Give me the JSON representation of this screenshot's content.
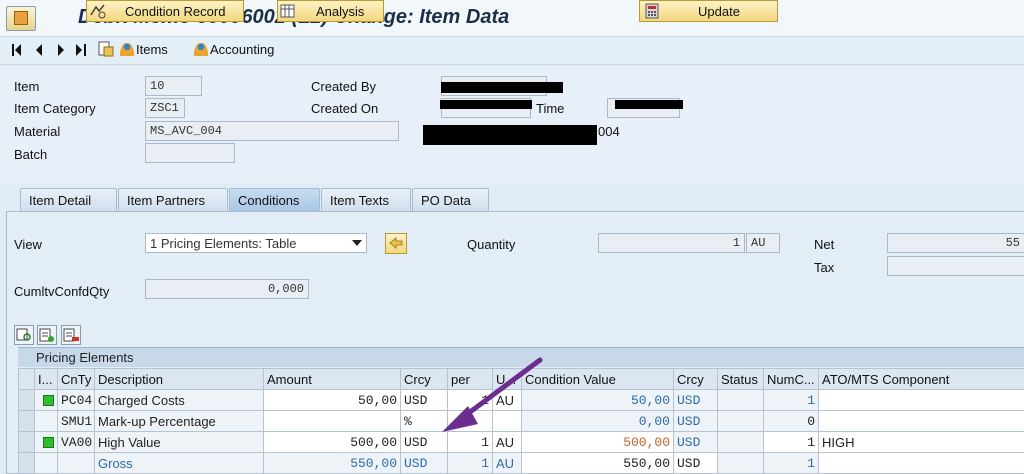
{
  "window": {
    "title": "Debit Memo 90006002  (L2) Change: Item Data"
  },
  "toolbar": {
    "items_label": "Items",
    "accounting_label": "Accounting"
  },
  "header": {
    "item_label": "Item",
    "item_value": "10",
    "item_category_label": "Item Category",
    "item_category_value": "ZSC1",
    "material_label": "Material",
    "material_value": "MS_AVC_004",
    "material_desc_suffix": "004",
    "batch_label": "Batch",
    "created_by_label": "Created By",
    "created_on_label": "Created On",
    "time_label": "Time"
  },
  "tabs": [
    {
      "label": "Item Detail"
    },
    {
      "label": "Item Partners"
    },
    {
      "label": "Conditions"
    },
    {
      "label": "Item Texts"
    },
    {
      "label": "PO Data"
    }
  ],
  "conditions": {
    "view_label": "View",
    "view_value": "1 Pricing Elements: Table",
    "quantity_label": "Quantity",
    "quantity_value": "1",
    "quantity_unit": "AU",
    "net_label": "Net",
    "net_value": "55",
    "tax_label": "Tax",
    "cumltv_label": "CumltvConfdQty",
    "cumltv_value": "0,000",
    "condition_record_label": "Condition Record",
    "analysis_label": "Analysis",
    "update_label": "Update",
    "pricing_elements_title": "Pricing Elements"
  },
  "grid": {
    "headers": [
      "I...",
      "CnTy",
      "Description",
      "Amount",
      "Crcy",
      "per",
      "U...",
      "Condition Value",
      "Crcy",
      "Status",
      "NumC...",
      "ATO/MTS Component"
    ],
    "rows": [
      {
        "cnty": "PC04",
        "desc": "Charged Costs",
        "amount": "50,00",
        "crcy": "USD",
        "per": "1",
        "uom": "AU",
        "cond_value": "50,00",
        "crcy2": "USD",
        "status": "",
        "numc": "1",
        "ato": ""
      },
      {
        "cnty": "SMU1",
        "desc": "Mark-up Percentage",
        "amount": "",
        "crcy": "%",
        "per": "",
        "uom": "",
        "cond_value": "0,00",
        "crcy2": "USD",
        "status": "",
        "numc": "0",
        "ato": ""
      },
      {
        "cnty": "VA00",
        "desc": "High Value",
        "amount": "500,00",
        "crcy": "USD",
        "per": "1",
        "uom": "AU",
        "cond_value": "500,00",
        "crcy2": "USD",
        "status": "",
        "numc": "1",
        "ato": "HIGH"
      },
      {
        "cnty": "",
        "desc": "Gross",
        "amount": "550,00",
        "crcy": "USD",
        "per": "1",
        "uom": "AU",
        "cond_value": "550,00",
        "crcy2": "USD",
        "status": "",
        "numc": "1",
        "ato": ""
      }
    ]
  },
  "colors": {
    "arrow": "#6b2d8f",
    "accent": "#2e6aa8",
    "button": "#f3d780"
  }
}
